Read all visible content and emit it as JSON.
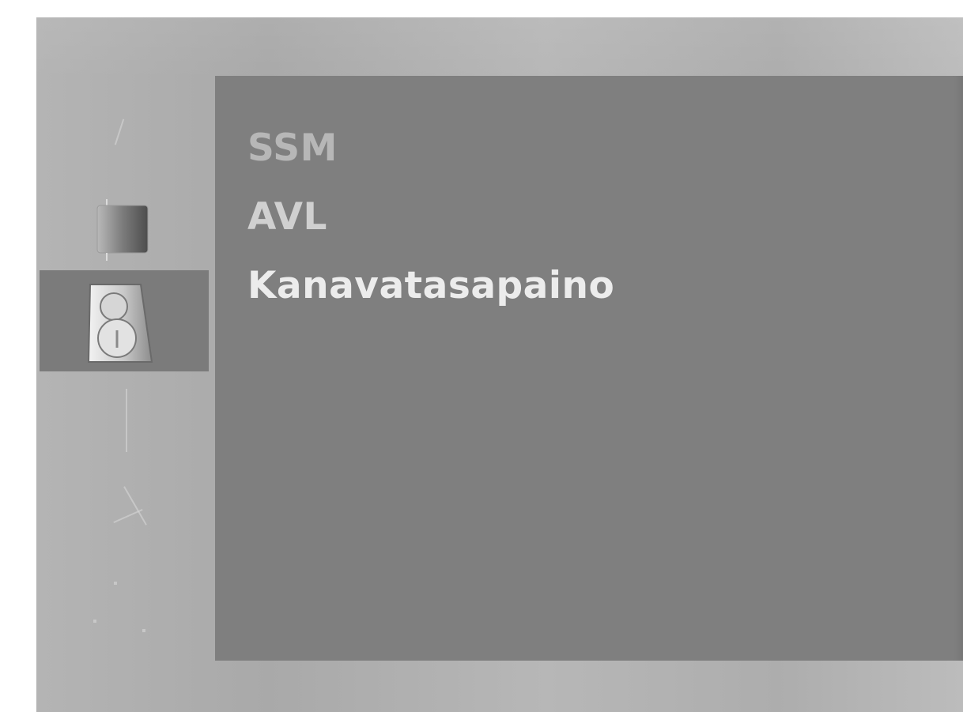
{
  "menu": {
    "items": [
      {
        "label": "SSM",
        "state": "dim"
      },
      {
        "label": "AVL",
        "state": "mid"
      },
      {
        "label": "Kanavatasapaino",
        "state": "active"
      }
    ]
  },
  "sidebar": {
    "icons": [
      {
        "name": "picture-icon",
        "selected": false
      },
      {
        "name": "sound-speaker-icon",
        "selected": true
      }
    ]
  },
  "colors": {
    "panel": "#7f7f7f",
    "selected_row": "#7b7b7b",
    "background": "#b4b4b4",
    "active_text": "#ececec",
    "dim_text": "#b7b7b7"
  }
}
